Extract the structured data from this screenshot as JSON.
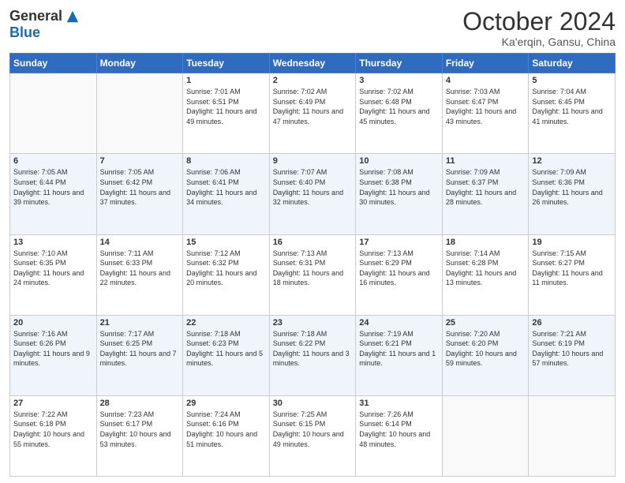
{
  "header": {
    "logo_general": "General",
    "logo_blue": "Blue",
    "month_title": "October 2024",
    "location": "Ka'erqin, Gansu, China"
  },
  "days_of_week": [
    "Sunday",
    "Monday",
    "Tuesday",
    "Wednesday",
    "Thursday",
    "Friday",
    "Saturday"
  ],
  "weeks": [
    [
      {
        "day": "",
        "info": ""
      },
      {
        "day": "",
        "info": ""
      },
      {
        "day": "1",
        "info": "Sunrise: 7:01 AM\nSunset: 6:51 PM\nDaylight: 11 hours and 49 minutes."
      },
      {
        "day": "2",
        "info": "Sunrise: 7:02 AM\nSunset: 6:49 PM\nDaylight: 11 hours and 47 minutes."
      },
      {
        "day": "3",
        "info": "Sunrise: 7:02 AM\nSunset: 6:48 PM\nDaylight: 11 hours and 45 minutes."
      },
      {
        "day": "4",
        "info": "Sunrise: 7:03 AM\nSunset: 6:47 PM\nDaylight: 11 hours and 43 minutes."
      },
      {
        "day": "5",
        "info": "Sunrise: 7:04 AM\nSunset: 6:45 PM\nDaylight: 11 hours and 41 minutes."
      }
    ],
    [
      {
        "day": "6",
        "info": "Sunrise: 7:05 AM\nSunset: 6:44 PM\nDaylight: 11 hours and 39 minutes."
      },
      {
        "day": "7",
        "info": "Sunrise: 7:05 AM\nSunset: 6:42 PM\nDaylight: 11 hours and 37 minutes."
      },
      {
        "day": "8",
        "info": "Sunrise: 7:06 AM\nSunset: 6:41 PM\nDaylight: 11 hours and 34 minutes."
      },
      {
        "day": "9",
        "info": "Sunrise: 7:07 AM\nSunset: 6:40 PM\nDaylight: 11 hours and 32 minutes."
      },
      {
        "day": "10",
        "info": "Sunrise: 7:08 AM\nSunset: 6:38 PM\nDaylight: 11 hours and 30 minutes."
      },
      {
        "day": "11",
        "info": "Sunrise: 7:09 AM\nSunset: 6:37 PM\nDaylight: 11 hours and 28 minutes."
      },
      {
        "day": "12",
        "info": "Sunrise: 7:09 AM\nSunset: 6:36 PM\nDaylight: 11 hours and 26 minutes."
      }
    ],
    [
      {
        "day": "13",
        "info": "Sunrise: 7:10 AM\nSunset: 6:35 PM\nDaylight: 11 hours and 24 minutes."
      },
      {
        "day": "14",
        "info": "Sunrise: 7:11 AM\nSunset: 6:33 PM\nDaylight: 11 hours and 22 minutes."
      },
      {
        "day": "15",
        "info": "Sunrise: 7:12 AM\nSunset: 6:32 PM\nDaylight: 11 hours and 20 minutes."
      },
      {
        "day": "16",
        "info": "Sunrise: 7:13 AM\nSunset: 6:31 PM\nDaylight: 11 hours and 18 minutes."
      },
      {
        "day": "17",
        "info": "Sunrise: 7:13 AM\nSunset: 6:29 PM\nDaylight: 11 hours and 16 minutes."
      },
      {
        "day": "18",
        "info": "Sunrise: 7:14 AM\nSunset: 6:28 PM\nDaylight: 11 hours and 13 minutes."
      },
      {
        "day": "19",
        "info": "Sunrise: 7:15 AM\nSunset: 6:27 PM\nDaylight: 11 hours and 11 minutes."
      }
    ],
    [
      {
        "day": "20",
        "info": "Sunrise: 7:16 AM\nSunset: 6:26 PM\nDaylight: 11 hours and 9 minutes."
      },
      {
        "day": "21",
        "info": "Sunrise: 7:17 AM\nSunset: 6:25 PM\nDaylight: 11 hours and 7 minutes."
      },
      {
        "day": "22",
        "info": "Sunrise: 7:18 AM\nSunset: 6:23 PM\nDaylight: 11 hours and 5 minutes."
      },
      {
        "day": "23",
        "info": "Sunrise: 7:18 AM\nSunset: 6:22 PM\nDaylight: 11 hours and 3 minutes."
      },
      {
        "day": "24",
        "info": "Sunrise: 7:19 AM\nSunset: 6:21 PM\nDaylight: 11 hours and 1 minute."
      },
      {
        "day": "25",
        "info": "Sunrise: 7:20 AM\nSunset: 6:20 PM\nDaylight: 10 hours and 59 minutes."
      },
      {
        "day": "26",
        "info": "Sunrise: 7:21 AM\nSunset: 6:19 PM\nDaylight: 10 hours and 57 minutes."
      }
    ],
    [
      {
        "day": "27",
        "info": "Sunrise: 7:22 AM\nSunset: 6:18 PM\nDaylight: 10 hours and 55 minutes."
      },
      {
        "day": "28",
        "info": "Sunrise: 7:23 AM\nSunset: 6:17 PM\nDaylight: 10 hours and 53 minutes."
      },
      {
        "day": "29",
        "info": "Sunrise: 7:24 AM\nSunset: 6:16 PM\nDaylight: 10 hours and 51 minutes."
      },
      {
        "day": "30",
        "info": "Sunrise: 7:25 AM\nSunset: 6:15 PM\nDaylight: 10 hours and 49 minutes."
      },
      {
        "day": "31",
        "info": "Sunrise: 7:26 AM\nSunset: 6:14 PM\nDaylight: 10 hours and 48 minutes."
      },
      {
        "day": "",
        "info": ""
      },
      {
        "day": "",
        "info": ""
      }
    ]
  ]
}
